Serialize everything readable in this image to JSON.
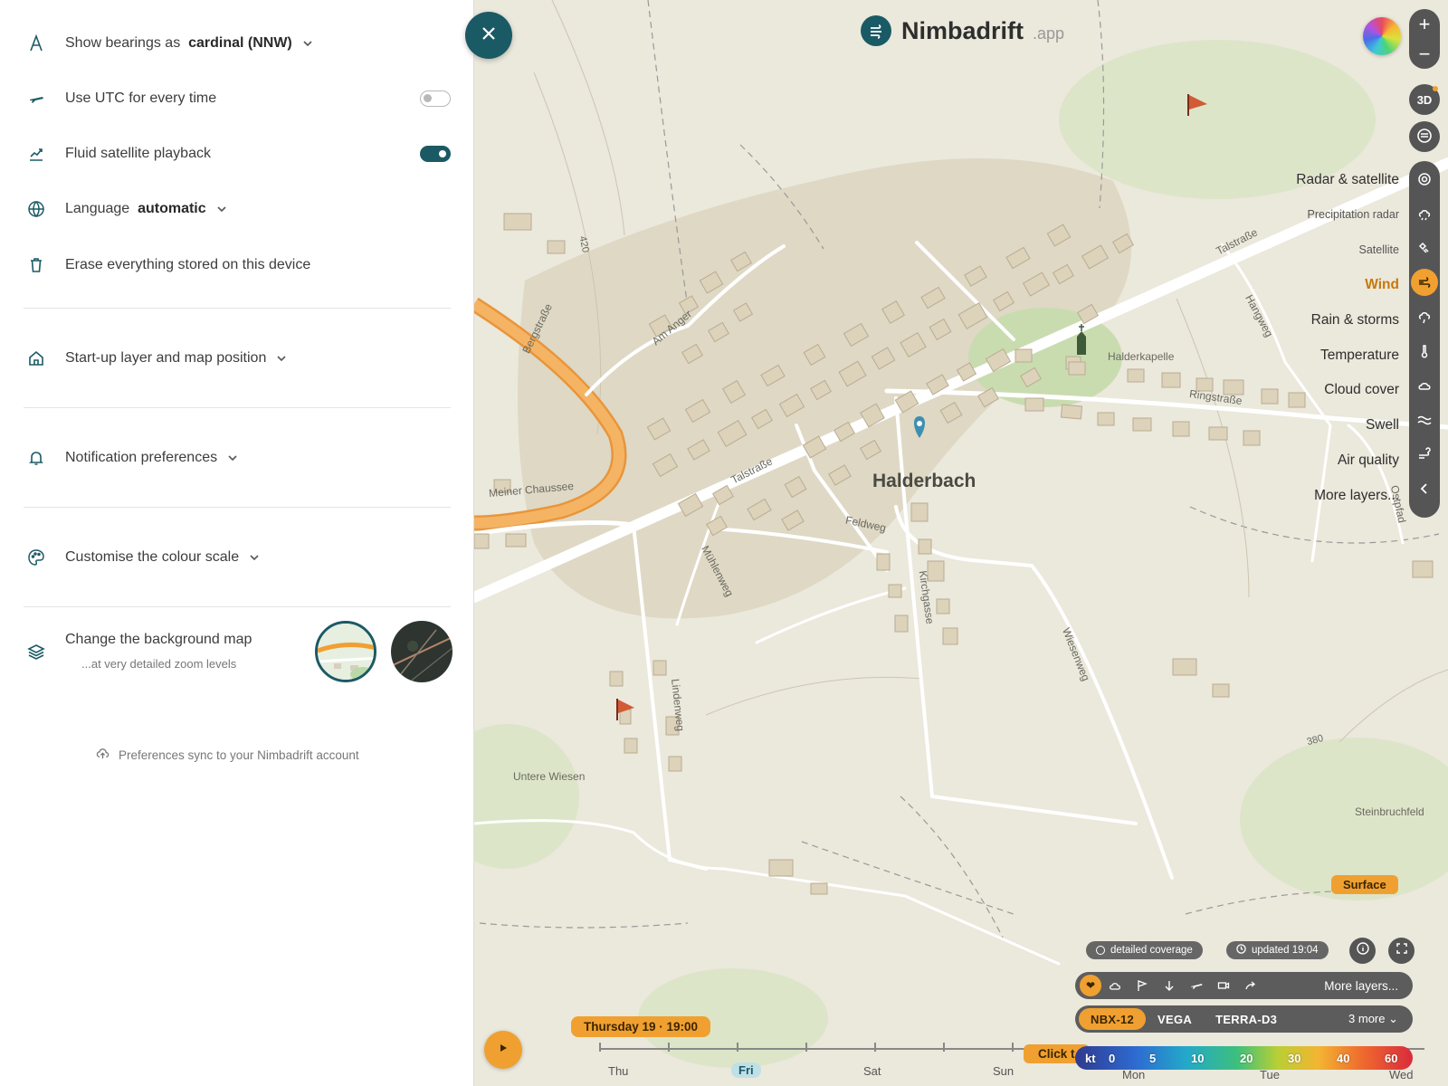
{
  "settings": {
    "bearings": {
      "label": "Show bearings as",
      "value": "cardinal (NNW)"
    },
    "utc": {
      "label": "Use UTC for every time",
      "enabled": false
    },
    "fluid": {
      "label": "Fluid satellite playback",
      "enabled": true
    },
    "language": {
      "label": "Language",
      "value": "automatic"
    },
    "erase": {
      "label": "Erase everything stored on this device"
    },
    "startup": {
      "label": "Start-up layer and map position"
    },
    "notifications": {
      "label": "Notification preferences"
    },
    "colour_scale": {
      "label": "Customise the colour scale"
    },
    "background": {
      "label": "Change the background map",
      "sub": "...at very detailed zoom levels"
    },
    "sync": "Preferences sync to your Nimbadrift account"
  },
  "brand": {
    "name": "Nimbadrift",
    "tld": ".app"
  },
  "map": {
    "toggle_3d": "3D",
    "layers": [
      {
        "label": "Radar & satellite",
        "icon": "radar-icon",
        "style": "normal"
      },
      {
        "label": "Precipitation radar",
        "icon": "precipitation-radar-icon",
        "style": "small"
      },
      {
        "label": "Satellite",
        "icon": "satellite-icon",
        "style": "small"
      },
      {
        "label": "Wind",
        "icon": "wind-icon",
        "style": "active"
      },
      {
        "label": "Rain & storms",
        "icon": "rain-icon",
        "style": "normal"
      },
      {
        "label": "Temperature",
        "icon": "thermometer-icon",
        "style": "normal"
      },
      {
        "label": "Cloud cover",
        "icon": "cloud-icon",
        "style": "normal"
      },
      {
        "label": "Swell",
        "icon": "swell-icon",
        "style": "normal"
      },
      {
        "label": "Air quality",
        "icon": "air-quality-icon",
        "style": "normal"
      },
      {
        "label": "More layers...",
        "icon": "chevron-left-icon",
        "style": "normal"
      }
    ],
    "place_labels": {
      "town": "Halderbach",
      "chapel": "Halderkapelle",
      "ringstrasse": "Ringstraße",
      "talstrasse1": "Talstraße",
      "talstrasse2": "Talstraße",
      "hangweg": "Hangweg",
      "am_anger": "Am Anger",
      "bergstrasse": "Bergstraße",
      "meiner_chaussee": "Meiner Chaussee",
      "feldweg": "Feldweg",
      "muehlenweg": "Mühlenweg",
      "kirchgasse": "Kirchgasse",
      "wiesenweg": "Wiesenweg",
      "lindenweg": "Lindenweg",
      "untere_wiesen": "Untere Wiesen",
      "steinbruchfeld": "Steinbruchfeld",
      "ostpfad": "Ostpfad",
      "elev_420": "420",
      "elev_380": "380"
    },
    "surface": "Surface",
    "coverage": "detailed coverage",
    "updated": "updated 19:04",
    "more_layers_bar": "More layers...",
    "models": [
      "NBX-12",
      "VEGA",
      "TERRA-D3"
    ],
    "models_more": "3 more ⌄",
    "current_time": "Thursday 19 · 19:00",
    "click_hint": "Click t",
    "days": [
      "Thu",
      "Fri",
      "Sat",
      "Sun",
      "Mon",
      "Tue",
      "Wed"
    ],
    "scale_unit": "kt",
    "scale_values": [
      "0",
      "5",
      "10",
      "20",
      "30",
      "40",
      "60"
    ]
  },
  "colors": {
    "accent": "#1a5a65",
    "highlight": "#f0a030",
    "road": "#f5a64a"
  }
}
